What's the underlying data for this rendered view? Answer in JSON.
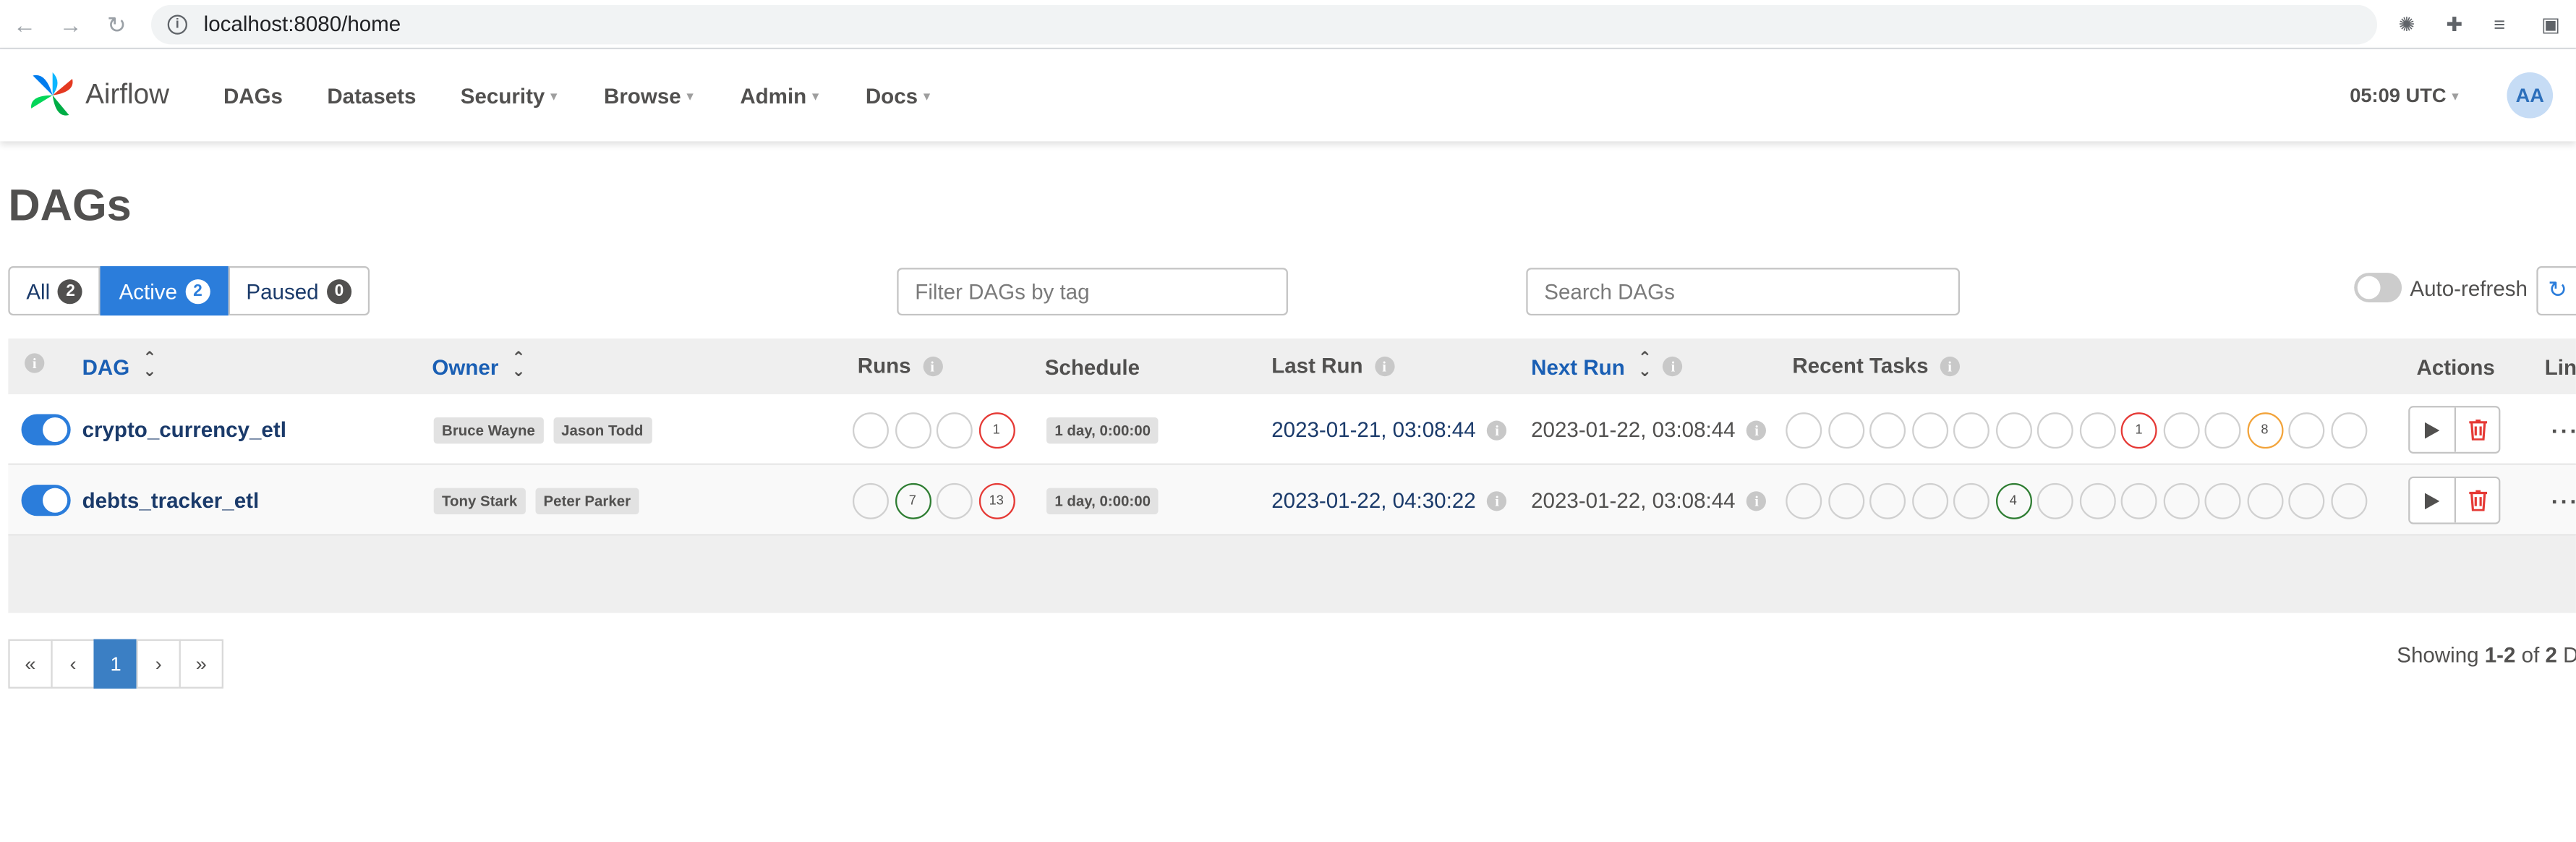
{
  "browser": {
    "url": "localhost:8080/home"
  },
  "nav": {
    "brand": "Airflow",
    "items": [
      "DAGs",
      "Datasets",
      "Security",
      "Browse",
      "Admin",
      "Docs"
    ],
    "time": "05:09 UTC",
    "avatar": "AA"
  },
  "page": {
    "title": "DAGs"
  },
  "filters": {
    "all": {
      "label": "All",
      "count": "2"
    },
    "active": {
      "label": "Active",
      "count": "2"
    },
    "paused": {
      "label": "Paused",
      "count": "0"
    },
    "tag_placeholder": "Filter DAGs by tag",
    "search_placeholder": "Search DAGs",
    "autorefresh": "Auto-refresh"
  },
  "table": {
    "headers": {
      "dag": "DAG",
      "owner": "Owner",
      "runs": "Runs",
      "schedule": "Schedule",
      "last_run": "Last Run",
      "next_run": "Next Run",
      "recent_tasks": "Recent Tasks",
      "actions": "Actions",
      "links": "Lin"
    },
    "rows": [
      {
        "name": "crypto_currency_etl",
        "owners": [
          "Bruce Wayne",
          "Jason Todd"
        ],
        "runs": [
          "",
          "",
          "",
          "1"
        ],
        "schedule": "1 day, 0:00:00",
        "last_run": "2023-01-21, 03:08:44",
        "next_run": "2023-01-22, 03:08:44",
        "recent_tasks": [
          "",
          "",
          "",
          "",
          "",
          "",
          "",
          "",
          "1",
          "",
          "",
          "8",
          "",
          ""
        ]
      },
      {
        "name": "debts_tracker_etl",
        "owners": [
          "Tony Stark",
          "Peter Parker"
        ],
        "runs": [
          "",
          "7",
          "",
          "13"
        ],
        "schedule": "1 day, 0:00:00",
        "last_run": "2023-01-22, 04:30:22",
        "next_run": "2023-01-22, 03:08:44",
        "recent_tasks": [
          "",
          "",
          "",
          "",
          "",
          "4",
          "",
          "",
          "",
          "",
          "",
          "",
          "",
          ""
        ]
      }
    ]
  },
  "pagination": {
    "first": "«",
    "prev": "‹",
    "current": "1",
    "next": "›",
    "last": "»"
  },
  "showing": {
    "prefix": "Showing ",
    "range": "1-2",
    "mid": " of ",
    "total": "2",
    "suffix": " DA"
  },
  "colors": {
    "accent": "#2b7ddb",
    "failed": "#e53935",
    "success": "#2e7d32",
    "upstream_failed": "#f2a33a"
  }
}
